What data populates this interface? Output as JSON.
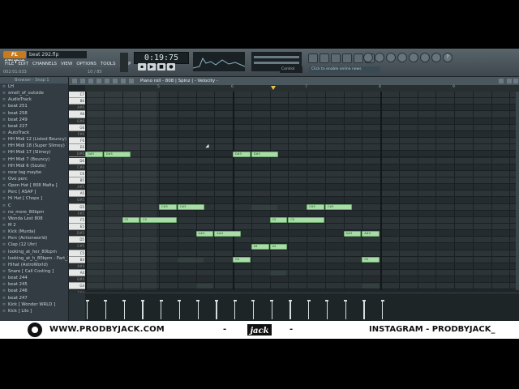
{
  "app": {
    "brand": "FL STUDIO",
    "project": "beat 292.flp",
    "menu": [
      "FILE",
      "EDIT",
      "CHANNELS",
      "VIEW",
      "OPTIONS",
      "TOOLS",
      "HELP"
    ],
    "status_left": "002:01:033",
    "status_right": "10 / 85",
    "time": "0:19:75",
    "pattern": "Control",
    "online": "Click to enable online news",
    "right_icons": [
      "gear-icon",
      "gear-icon",
      "gear-icon",
      "gear-icon",
      "gear-icon",
      "gear-icon",
      "gear-icon",
      "?"
    ]
  },
  "browser": {
    "header": "Browser - Snap 1",
    "items": [
      "LH",
      "smell_of_outside",
      "AudioTrack",
      "beat 251",
      "beat 258",
      "beat 249",
      "beat 227",
      "AutoTrack",
      "HH Midi 12 (Listed Bouncy)",
      "HH Midi 18 (Super Slimey)",
      "HH Midi 17 (Slimey)",
      "HH Midi 7 (Bouncy)",
      "HH Midi 6 (Sizzle)",
      "new tag maybe",
      "Ovo perc",
      "Open Hat [ 808 Mafia ]",
      "Perc [ ASAP ]",
      "Hi Hat [ Chops ]",
      "C",
      "no_more_80bpm",
      "Wonda Lest 808",
      "M 2",
      "Kick (Murda)",
      "Perc (Actionworld)",
      "Clap (12 Uhr)",
      "looking_at_her_80bpm",
      "looking_at_h_80bpm - Part_1",
      "Hihat (AstroWorld)",
      "Snare [ Call Costing ]",
      "beat 244",
      "beat 245",
      "beat 246",
      "beat 247",
      "Kick [ Wonder WRLD ]",
      "Kick [ Lilo ]"
    ]
  },
  "piano_roll": {
    "title": "Piano roll - 808 | Spinz | - Velocity -",
    "ruler": [
      "5",
      "6",
      "7",
      "8",
      "9",
      "10"
    ],
    "keys": [
      "C7",
      "B6",
      "A#6",
      "A6",
      "G#6",
      "G6",
      "F#6",
      "F6",
      "E6",
      "D#6",
      "D6",
      "C#6",
      "C6",
      "B5",
      "A#5",
      "A5",
      "G#5",
      "G5",
      "F#5",
      "F5",
      "E5",
      "D#5",
      "D5",
      "C#5",
      "C5",
      "B4",
      "A#4",
      "A4",
      "G#4",
      "G4",
      "F#4",
      "F4",
      "E4",
      "D#4",
      "D4",
      "C#4",
      "C4"
    ],
    "notes": [
      {
        "label": "D#5",
        "row": 9,
        "start": 0,
        "len": 0.5
      },
      {
        "label": "D#5",
        "row": 9,
        "start": 0.5,
        "len": 0.75
      },
      {
        "label": "C#5",
        "row": 17,
        "start": 2,
        "len": 0.5
      },
      {
        "label": "C#5",
        "row": 17,
        "start": 2.5,
        "len": 0.75
      },
      {
        "label": "C5",
        "row": 19,
        "start": 1,
        "len": 0.5
      },
      {
        "label": "C5",
        "row": 19,
        "start": 1.5,
        "len": 1
      },
      {
        "label": "A#4",
        "row": 21,
        "start": 3,
        "len": 0.5
      },
      {
        "label": "A#4",
        "row": 21,
        "start": 3.5,
        "len": 0.75
      },
      {
        "label": "A4",
        "row": 23,
        "start": 4.5,
        "len": 0.5
      },
      {
        "label": "A4",
        "row": 23,
        "start": 5,
        "len": 0.5
      },
      {
        "label": "G4",
        "row": 25,
        "start": 4,
        "len": 0.5
      },
      {
        "label": "D#5",
        "row": 9,
        "start": 4,
        "len": 0.5
      },
      {
        "label": "D#5",
        "row": 9,
        "start": 4.5,
        "len": 0.75
      },
      {
        "label": "C#5",
        "row": 17,
        "start": 6,
        "len": 0.5
      },
      {
        "label": "C#5",
        "row": 17,
        "start": 6.5,
        "len": 0.75
      },
      {
        "label": "C5",
        "row": 19,
        "start": 5,
        "len": 0.5
      },
      {
        "label": "C5",
        "row": 19,
        "start": 5.5,
        "len": 1
      },
      {
        "label": "A#4",
        "row": 21,
        "start": 7,
        "len": 0.5
      },
      {
        "label": "A#4",
        "row": 21,
        "start": 7.5,
        "len": 0.5
      },
      {
        "label": "G4",
        "row": 25,
        "start": 7.5,
        "len": 0.5
      }
    ],
    "velocities": [
      0,
      0.5,
      1,
      1.5,
      2,
      2.5,
      3,
      3.5,
      4,
      4.5,
      5,
      5.5,
      6,
      6.5,
      7,
      7.5,
      8
    ]
  },
  "banner": {
    "site": "WWW.PRODBYJACK.COM",
    "dash": "-",
    "wordmark": "jack",
    "instagram": "INSTAGRAM - PRODBYJACK_"
  }
}
